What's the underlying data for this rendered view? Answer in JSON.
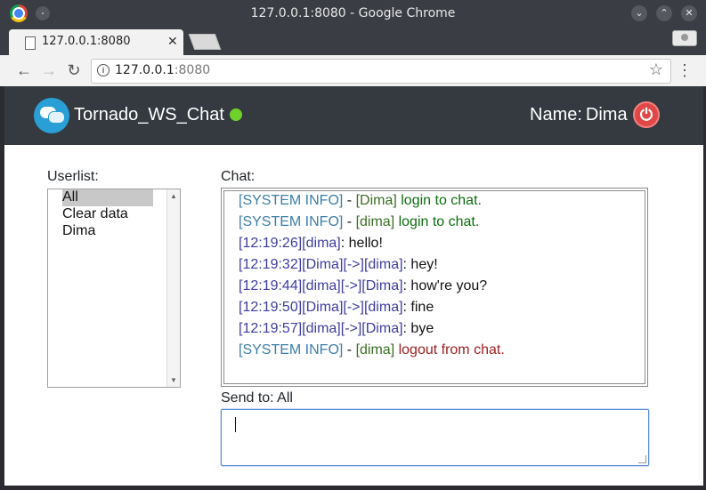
{
  "window": {
    "title": "127.0.0.1:8080 - Google Chrome"
  },
  "tab": {
    "title": "127.0.0.1:8080",
    "close": "✕"
  },
  "address": {
    "host": "127.0.0.1",
    "port": ":8080"
  },
  "icons": {
    "back": "←",
    "forward": "→",
    "reload": "↻",
    "star": "☆",
    "menu": "⋮",
    "info": "i",
    "minimize": "⌄",
    "maximize": "⌃",
    "close": "✕",
    "power": "⏻"
  },
  "app": {
    "brand": "Tornado_WS_Chat",
    "user_label": "Name:",
    "user_name": "Dima",
    "status_color": "#6fd22a"
  },
  "userlist": {
    "label": "Userlist:",
    "options": [
      "All",
      "Clear data",
      "Dima"
    ],
    "selected": "All"
  },
  "chat": {
    "label": "Chat:",
    "messages": [
      {
        "prefix": "[SYSTEM INFO]",
        "sep": " - ",
        "user": "[Dima]",
        "text": " login to chat."
      },
      {
        "prefix": "[SYSTEM INFO]",
        "sep": " - ",
        "user": "[dima]",
        "text": " login to chat."
      },
      {
        "prefix": "[12:19:26][dima]",
        "text": ": hello!"
      },
      {
        "prefix": "[12:19:32][Dima][->][dima]",
        "text": ": hey!"
      },
      {
        "prefix": "[12:19:44][dima][->][Dima]",
        "text": ": how're you?"
      },
      {
        "prefix": "[12:19:50][Dima][->][dima]",
        "text": ": fine"
      },
      {
        "prefix": "[12:19:57][dima][->][Dima]",
        "text": ": bye"
      },
      {
        "prefix": "[SYSTEM INFO]",
        "sep": " - ",
        "user": "[dima]",
        "text": " logout from chat."
      }
    ]
  },
  "send": {
    "label": "Send to: All",
    "value": ""
  }
}
